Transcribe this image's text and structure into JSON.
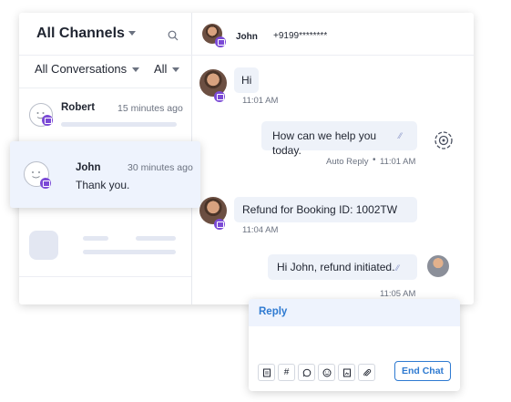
{
  "sidebar": {
    "title": "All Channels",
    "filter_conversations": "All Conversations",
    "filter_status": "All",
    "conversations": [
      {
        "name": "Robert",
        "time": "15 minutes ago"
      },
      {
        "name": "John",
        "time": "30 minutes ago",
        "preview": "Thank you."
      }
    ]
  },
  "chat": {
    "contact_name": "John",
    "contact_phone": "+9199********",
    "messages": [
      {
        "text": "Hi",
        "time": "11:01 AM"
      },
      {
        "text": "How can we help you today.",
        "sender": "Auto Reply",
        "time": "11:01 AM"
      },
      {
        "text": "Refund for Booking ID: 1002TW",
        "time": "11:04 AM"
      },
      {
        "text": "Hi John, refund initiated.",
        "time": "11:05 AM"
      }
    ]
  },
  "reply_box": {
    "tab_label": "Reply",
    "end_chat_label": "End Chat",
    "tools": [
      "note-icon",
      "hash-icon",
      "whatsapp-icon",
      "emoji-icon",
      "attachment-file-icon",
      "paperclip-icon"
    ]
  },
  "colors": {
    "accent": "#2e7ad1",
    "channel_badge": "#7b4ad6",
    "bubble": "#eef2f9",
    "selected": "#eef3fd"
  }
}
